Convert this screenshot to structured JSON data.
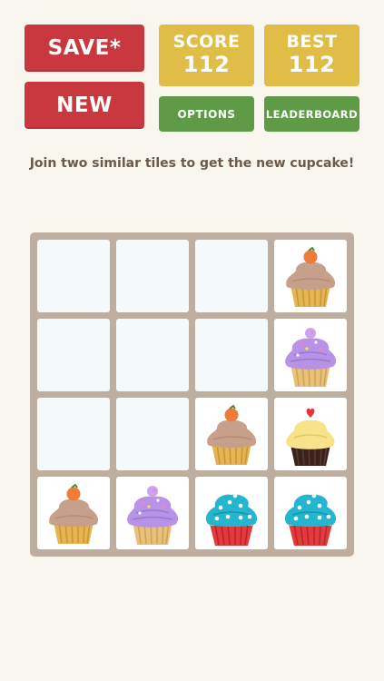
{
  "buttons": {
    "save_label": "SAVE*",
    "new_label": "NEW",
    "options_label": "OPTIONS",
    "leaderboard_label": "LEADERBOARD"
  },
  "score": {
    "label": "SCORE",
    "value": "112"
  },
  "best": {
    "label": "BEST",
    "value": "112"
  },
  "instruction": "Join two similar tiles to get the new cupcake!",
  "board": {
    "rows": [
      [
        "empty",
        "empty",
        "empty",
        "peach-cupcake-icon"
      ],
      [
        "empty",
        "empty",
        "empty",
        "purple-sprinkle-cupcake-icon"
      ],
      [
        "empty",
        "empty",
        "peach-cupcake-icon",
        "yellow-heart-cupcake-icon"
      ],
      [
        "peach-cupcake-icon",
        "purple-sprinkle-cupcake-icon",
        "blue-pearl-cupcake-icon",
        "blue-pearl-cupcake-icon"
      ]
    ]
  },
  "colors": {
    "background": "#f9f6f0",
    "red_button": "#c9373f",
    "score_box": "#e0bd46",
    "green_button": "#5f9a46",
    "board": "#bdaea0",
    "empty_tile": "#f4f9fc"
  }
}
